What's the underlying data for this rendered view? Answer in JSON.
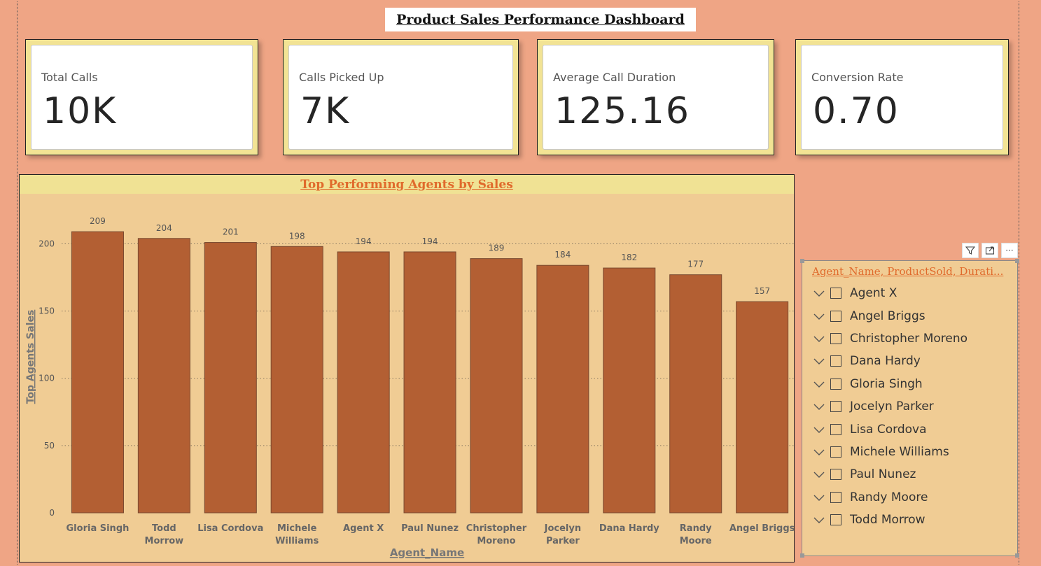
{
  "dashboard": {
    "title": "Product Sales Performance Dashboard"
  },
  "kpis": [
    {
      "label": "Total Calls",
      "value": "10K"
    },
    {
      "label": "Calls Picked Up",
      "value": "7K"
    },
    {
      "label": "Average Call Duration",
      "value": "125.16"
    },
    {
      "label": "Conversion Rate",
      "value": "0.70"
    }
  ],
  "chart": {
    "title": "Top Performing Agents by Sales"
  },
  "chart_data": {
    "type": "bar",
    "title": "Top Performing Agents by Sales",
    "xlabel": "Agent_Name",
    "ylabel": "Top Agents Sales",
    "categories": [
      [
        "Gloria Singh"
      ],
      [
        "Todd",
        "Morrow"
      ],
      [
        "Lisa Cordova"
      ],
      [
        "Michele",
        "Williams"
      ],
      [
        "Agent X"
      ],
      [
        "Paul Nunez"
      ],
      [
        "Christopher",
        "Moreno"
      ],
      [
        "Jocelyn",
        "Parker"
      ],
      [
        "Dana Hardy"
      ],
      [
        "Randy",
        "Moore"
      ],
      [
        "Angel Briggs"
      ]
    ],
    "values": [
      209,
      204,
      201,
      198,
      194,
      194,
      189,
      184,
      182,
      177,
      157
    ],
    "data_labels": [
      "209",
      "204",
      "201",
      "198",
      "194",
      "194",
      "189",
      "184",
      "182",
      "177",
      "157"
    ],
    "yticks": [
      0,
      50,
      100,
      150,
      200
    ],
    "ylim": [
      0,
      220
    ],
    "grid": true,
    "bar_color": "#b35f33",
    "panel_bg": "#f0cc94"
  },
  "slicer": {
    "title": "Agent_Name, ProductSold, Durati...",
    "items": [
      "Agent X",
      "Angel Briggs",
      "Christopher Moreno",
      "Dana Hardy",
      "Gloria Singh",
      "Jocelyn Parker",
      "Lisa Cordova",
      "Michele Williams",
      "Paul Nunez",
      "Randy Moore",
      "Todd Morrow"
    ]
  },
  "visual_header": {
    "icons": [
      "filter-icon",
      "focus-mode-icon",
      "more-options-icon"
    ],
    "more_label": "···"
  },
  "colors": {
    "page_bg": "#efa585",
    "card_frame": "#f2e394",
    "accent_title": "#e06a2c"
  }
}
